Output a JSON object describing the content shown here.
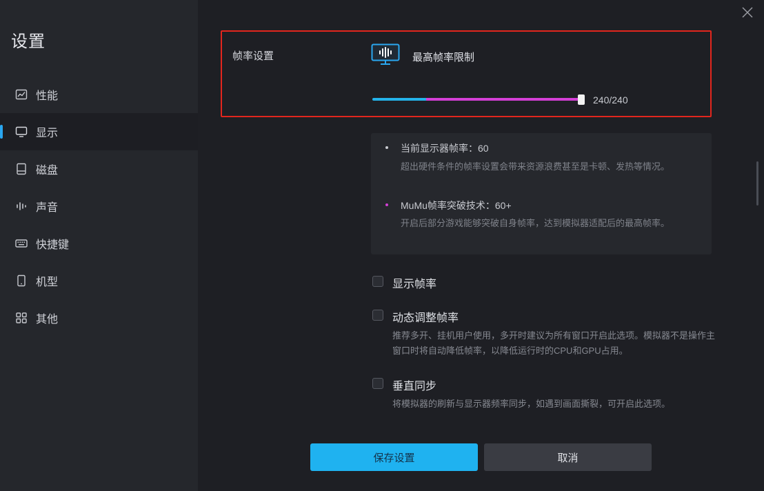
{
  "sidebar": {
    "title": "设置",
    "items": [
      {
        "label": "性能",
        "icon": "chart-icon"
      },
      {
        "label": "显示",
        "icon": "monitor-icon",
        "active": true
      },
      {
        "label": "磁盘",
        "icon": "disk-icon"
      },
      {
        "label": "声音",
        "icon": "sound-icon"
      },
      {
        "label": "快捷键",
        "icon": "keyboard-icon"
      },
      {
        "label": "机型",
        "icon": "phone-icon"
      },
      {
        "label": "其他",
        "icon": "grid-icon"
      }
    ]
  },
  "frame_rate": {
    "section_label": "帧率设置",
    "slider_title": "最高帧率限制",
    "slider_value_text": "240/240",
    "slider_fraction": 1.0,
    "accent_colors": {
      "low": "#24b3ea",
      "high": "#d43fd6",
      "highlight_border": "#e3261d"
    }
  },
  "info": {
    "items": [
      {
        "title": "当前显示器帧率：60",
        "desc": "超出硬件条件的帧率设置会带来资源浪费甚至是卡顿、发热等情况。",
        "dot_color": "#c9cbd1"
      },
      {
        "title": "MuMu帧率突破技术：60+",
        "desc": "开启后部分游戏能够突破自身帧率，达到模拟器适配后的最高帧率。",
        "dot_color": "#d43fd6"
      }
    ]
  },
  "options": {
    "show_fps": {
      "label": "显示帧率",
      "checked": false
    },
    "dynamic_fps": {
      "label": "动态调整帧率",
      "checked": false,
      "desc": "推荐多开、挂机用户使用，多开时建议为所有窗口开启此选项。模拟器不是操作主窗口时将自动降低帧率，以降低运行时的CPU和GPU占用。"
    },
    "vsync": {
      "label": "垂直同步",
      "checked": false,
      "desc": "将模拟器的刷新与显示器频率同步，如遇到画面撕裂，可开启此选项。"
    }
  },
  "buttons": {
    "save": "保存设置",
    "cancel": "取消"
  },
  "colors": {
    "save_button": "#1fb2f0",
    "cancel_button": "#3a3c43"
  }
}
